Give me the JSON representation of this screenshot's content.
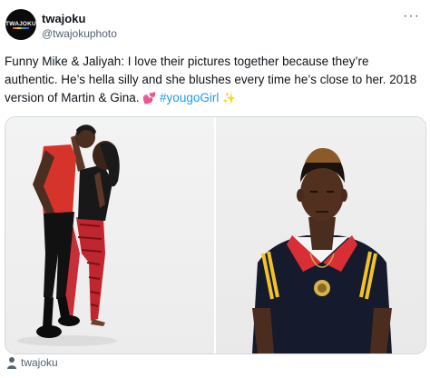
{
  "tweet": {
    "avatar_text": "TWAJOKU",
    "display_name": "twajoku",
    "handle": "@twajokuphoto",
    "more_label": "···",
    "text_part1": "Funny Mike & Jaliyah: I love their pictures together because they’re authentic. He’s hella silly and she blushes every time he’s close to her. 2018 version of Martin & Gina.",
    "emoji_hearts": "💕",
    "hashtag": "#yougoGirl",
    "emoji_sparkles": "✨"
  },
  "media": {
    "left_photo": "couple-portrait-photo",
    "right_photo": "man-portrait-photo"
  },
  "footer": {
    "tagged_user": "twajoku"
  },
  "colors": {
    "link": "#1d9bf0",
    "muted": "#536471"
  }
}
